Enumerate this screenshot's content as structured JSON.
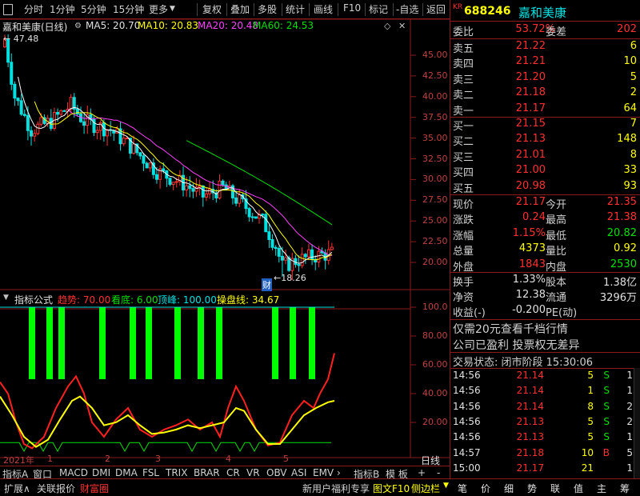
{
  "toolbar": {
    "items": [
      "分时",
      "1分钟",
      "5分钟",
      "15分钟",
      "更多",
      "复权",
      "叠加",
      "多股",
      "统计",
      "画线",
      "F10",
      "标记",
      "-自选",
      "返回"
    ]
  },
  "main_chart": {
    "title": "嘉和美康(日线)",
    "ma5_label": "MA5: 20.70",
    "ma10_label": "MA10: 20.83",
    "ma20_label": "MA20: 20.48",
    "ma60_label": "MA60: 24.53",
    "high_label": "47.48",
    "low_label": "18.26",
    "event_label": "财",
    "colors": {
      "ma5": "#ffffff",
      "ma10": "#ffff00",
      "ma20": "#ff40ff",
      "ma60": "#00e000"
    },
    "y_ticks": [
      "45.00",
      "42.50",
      "40.00",
      "37.50",
      "35.00",
      "32.50",
      "30.00",
      "27.50",
      "25.00",
      "22.50",
      "20.00"
    ]
  },
  "indicator": {
    "name": "指标公式",
    "trend_label": "趋势: 70.00",
    "bottom_label": "看底: 6.00",
    "top_label": "顶峰: 100.00",
    "ops_label": "操盘线: 34.67",
    "y_ticks": [
      "100.0",
      "80.00",
      "60.00",
      "40.00",
      "20.00"
    ]
  },
  "x_axis": {
    "labels": [
      "2021年",
      "1",
      "2",
      "3",
      "4",
      "5"
    ],
    "right_label": "日线"
  },
  "indicator_tabs": [
    "指标A",
    "窗口",
    "MACD",
    "DMI",
    "DMA",
    "FSL",
    "TRIX",
    "BRAR",
    "CR",
    "VR",
    "OBV",
    "ASI",
    "EMV",
    "指标B",
    "模 板",
    "+",
    "-"
  ],
  "bottom_bar": [
    "扩展∧",
    "关联报价",
    "财富圈",
    "新用户福利专享",
    "图文F10",
    "侧边栏"
  ],
  "bottom_icons": [
    "笔",
    "价",
    "细",
    "势",
    "联",
    "值",
    "主",
    "筹"
  ],
  "quote": {
    "code_prefix": "KR",
    "code": "688246",
    "name": "嘉和美康",
    "weibi_label": "委比",
    "weibi": "53.72%",
    "weicha_label": "委差",
    "weicha": "202",
    "asks": [
      {
        "label": "卖五",
        "price": "21.22",
        "vol": "6"
      },
      {
        "label": "卖四",
        "price": "21.21",
        "vol": "10"
      },
      {
        "label": "卖三",
        "price": "21.20",
        "vol": "5"
      },
      {
        "label": "卖二",
        "price": "21.18",
        "vol": "2"
      },
      {
        "label": "卖一",
        "price": "21.17",
        "vol": "64"
      }
    ],
    "bids": [
      {
        "label": "买一",
        "price": "21.15",
        "vol": "7"
      },
      {
        "label": "买二",
        "price": "21.13",
        "vol": "148"
      },
      {
        "label": "买三",
        "price": "21.01",
        "vol": "8"
      },
      {
        "label": "买四",
        "price": "21.00",
        "vol": "33"
      },
      {
        "label": "买五",
        "price": "20.98",
        "vol": "93"
      }
    ],
    "stats": [
      {
        "l1": "现价",
        "v1": "21.17",
        "l2": "今开",
        "v2": "21.35"
      },
      {
        "l1": "涨跌",
        "v1": "0.24",
        "l2": "最高",
        "v2": "21.38"
      },
      {
        "l1": "涨幅",
        "v1": "1.15%",
        "l2": "最低",
        "v2": "20.82"
      },
      {
        "l1": "总量",
        "v1": "4373",
        "l2": "量比",
        "v2": "0.92"
      },
      {
        "l1": "外盘",
        "v1": "1843",
        "l2": "内盘",
        "v2": "2530"
      }
    ],
    "stats2": [
      {
        "l1": "换手",
        "v1": "1.33%",
        "l2": "股本",
        "v2": "1.38亿"
      },
      {
        "l1": "净资",
        "v1": "12.38",
        "l2": "流通",
        "v2": "3296万"
      },
      {
        "l1": "收益(-)",
        "v1": "-0.200",
        "l2": "PE(动)",
        "v2": ""
      }
    ],
    "promo1": "仅需20元查看千档行情",
    "promo2": "公司已盈利 投票权无差异",
    "status": "交易状态: 闭市阶段 15:30:06",
    "trades": [
      {
        "time": "14:56",
        "price": "21.14",
        "vol": "5",
        "side": "S",
        "n": "1"
      },
      {
        "time": "14:56",
        "price": "21.14",
        "vol": "1",
        "side": "S",
        "n": "1"
      },
      {
        "time": "14:56",
        "price": "21.14",
        "vol": "8",
        "side": "S",
        "n": "2"
      },
      {
        "time": "14:56",
        "price": "21.13",
        "vol": "5",
        "side": "S",
        "n": "2"
      },
      {
        "time": "14:56",
        "price": "21.13",
        "vol": "5",
        "side": "S",
        "n": "1"
      },
      {
        "time": "14:57",
        "price": "21.18",
        "vol": "10",
        "side": "B",
        "n": "5"
      },
      {
        "time": "15:00",
        "price": "21.17",
        "vol": "21",
        "side": "",
        "n": "1"
      }
    ]
  }
}
